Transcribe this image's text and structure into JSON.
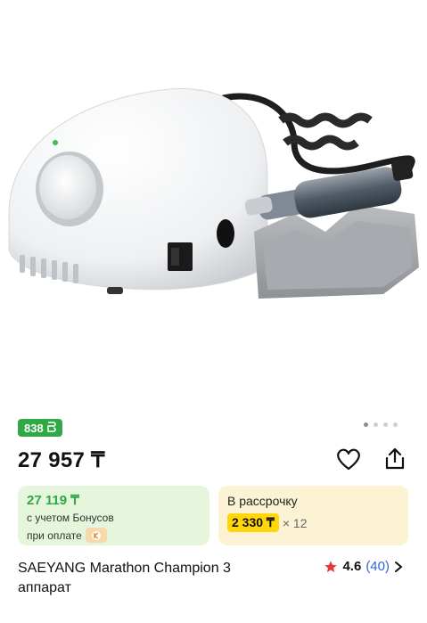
{
  "bonus_badge": {
    "value": "838",
    "icon": "bonus-coin-icon"
  },
  "gallery": {
    "dots_count": 4,
    "active_index": 0
  },
  "price": "27 957 ₸",
  "actions": {
    "favorite_icon": "heart-icon",
    "share_icon": "share-icon"
  },
  "bonus_card": {
    "price": "27 119 ₸",
    "line1": "с учетом Бонусов",
    "line2": "при оплате",
    "pay_icon": "kaspi-pay-icon"
  },
  "installment_card": {
    "title": "В рассрочку",
    "amount": "2 330 ₸",
    "multiplier": "× 12"
  },
  "product": {
    "title": "SAEYANG Marathon Champion 3 аппарат"
  },
  "rating": {
    "value": "4.6",
    "count": "(40)",
    "star_color": "#e53935"
  },
  "colors": {
    "green": "#2fa845",
    "yellow": "#ffd60a",
    "link": "#2b65d9"
  }
}
